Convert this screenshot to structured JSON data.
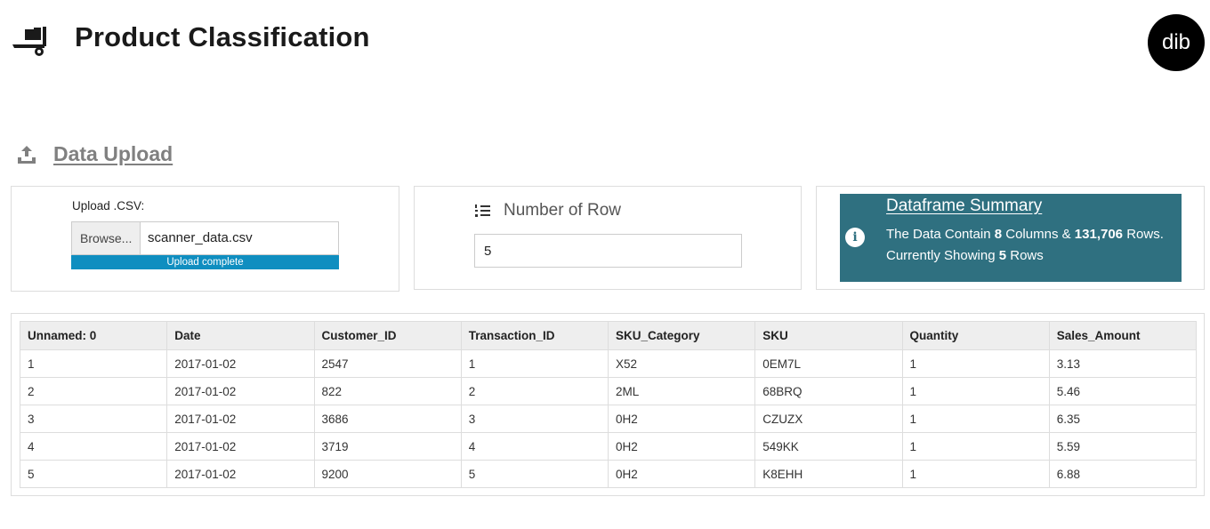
{
  "header": {
    "logo_icon": "dolly-icon",
    "title": "Product Classification",
    "avatar_text": "dib"
  },
  "section": {
    "icon": "upload-icon",
    "title": "Data Upload"
  },
  "upload": {
    "label": "Upload .CSV:",
    "browse_label": "Browse...",
    "file_name": "scanner_data.csv",
    "progress_text": "Upload complete",
    "progress": 1.0
  },
  "rows": {
    "icon": "list-ol-icon",
    "label": "Number of Row",
    "value": "5"
  },
  "summary": {
    "icon": "info-icon",
    "title": "Dataframe Summary",
    "line1_prefix": "The Data Contain ",
    "columns": "8",
    "line1_mid": " Columns & ",
    "rows_total": "131,706",
    "line1_suffix": " Rows.",
    "line2_prefix": "Currently Showing ",
    "rows_showing": "5",
    "line2_suffix": " Rows",
    "color": "#2f7080"
  },
  "table": {
    "columns": [
      "Unnamed: 0",
      "Date",
      "Customer_ID",
      "Transaction_ID",
      "SKU_Category",
      "SKU",
      "Quantity",
      "Sales_Amount"
    ],
    "rows": [
      [
        "1",
        "2017-01-02",
        "2547",
        "1",
        "X52",
        "0EM7L",
        "1",
        "3.13"
      ],
      [
        "2",
        "2017-01-02",
        "822",
        "2",
        "2ML",
        "68BRQ",
        "1",
        "5.46"
      ],
      [
        "3",
        "2017-01-02",
        "3686",
        "3",
        "0H2",
        "CZUZX",
        "1",
        "6.35"
      ],
      [
        "4",
        "2017-01-02",
        "3719",
        "4",
        "0H2",
        "549KK",
        "1",
        "5.59"
      ],
      [
        "5",
        "2017-01-02",
        "9200",
        "5",
        "0H2",
        "K8EHH",
        "1",
        "6.88"
      ]
    ]
  },
  "colors": {
    "progress": "#0f8ec0",
    "summary_bg": "#2f7080",
    "section_title": "#808080"
  }
}
